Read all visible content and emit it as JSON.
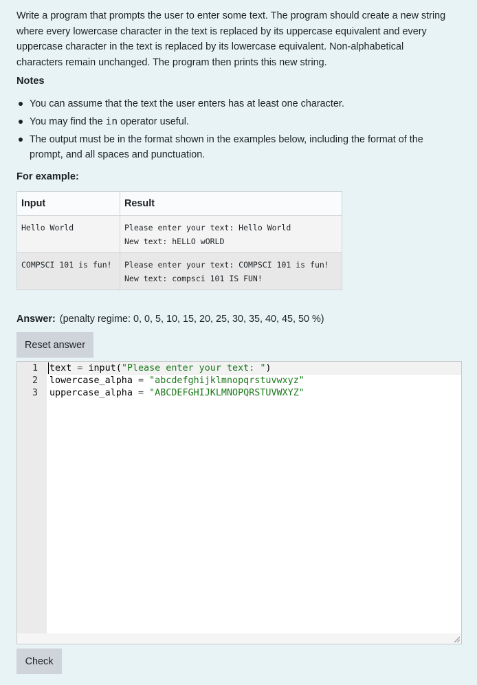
{
  "question": {
    "prompt": "Write a program that prompts the user to enter some text. The program should create a new string where every lowercase character in the text is replaced by its uppercase equivalent and every uppercase character in the text is replaced by its lowercase equivalent. Non-alphabetical characters remain unchanged. The program then prints this new string.",
    "notes_title": "Notes",
    "notes": {
      "n1": "You can assume that the text the user enters has at least one character.",
      "n2_before": "You may find the ",
      "n2_code": "in",
      "n2_after": " operator useful.",
      "n3": "The output must be in the format shown in the examples below, including the format of the prompt, and all spaces and punctuation."
    }
  },
  "examples": {
    "title": "For example:",
    "header_input": "Input",
    "header_result": "Result",
    "rows": [
      {
        "input": "Hello World",
        "result": "Please enter your text: Hello World\nNew text: hELLO wORLD"
      },
      {
        "input": "COMPSCI 101 is fun!",
        "result": "Please enter your text: COMPSCI 101 is fun!\nNew text: compsci 101 IS FUN!"
      }
    ]
  },
  "answer": {
    "label": "Answer:",
    "penalty": "(penalty regime: 0, 0, 5, 10, 15, 20, 25, 30, 35, 40, 45, 50 %)",
    "reset_label": "Reset answer",
    "check_label": "Check"
  },
  "editor": {
    "line_numbers": [
      "1",
      "2",
      "3"
    ],
    "lines": [
      {
        "name": "text",
        "op": " = ",
        "call": "input(",
        "str": "\"Please enter your text: \"",
        "close": ")"
      },
      {
        "name": "lowercase_alpha",
        "op": " = ",
        "str": "\"abcdefghijklmnopqrstuvwxyz\""
      },
      {
        "name": "uppercase_alpha",
        "op": " = ",
        "str": "\"ABCDEFGHIJKLMNOPQRSTUVWXYZ\""
      }
    ]
  }
}
